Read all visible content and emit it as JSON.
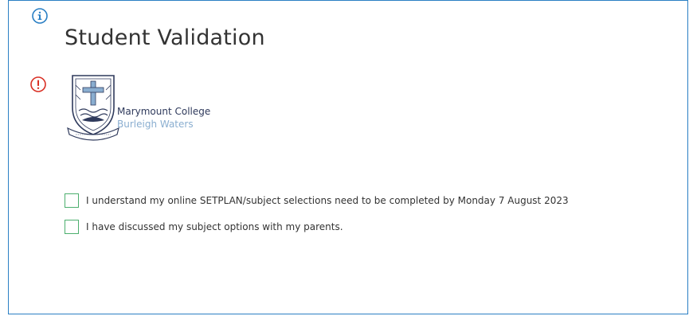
{
  "page": {
    "title": "Student Validation"
  },
  "icons": {
    "info": "info-icon",
    "warning": "alert-icon",
    "info_color": "#2a7fc4",
    "warning_color": "#d93025"
  },
  "school": {
    "name": "Marymount College",
    "location": "Burleigh Waters",
    "name_color": "#2f3a5c",
    "location_color": "#8aaed0"
  },
  "checklist": {
    "items": [
      {
        "label": "I understand my online SETPLAN/subject selections need to be completed by Monday 7 August 2023",
        "checked": false
      },
      {
        "label": "I have discussed my subject options with my parents.",
        "checked": false
      }
    ],
    "checkbox_color": "#4caf6e"
  },
  "colors": {
    "frame_border": "#2a7fc4",
    "text": "#333333"
  }
}
